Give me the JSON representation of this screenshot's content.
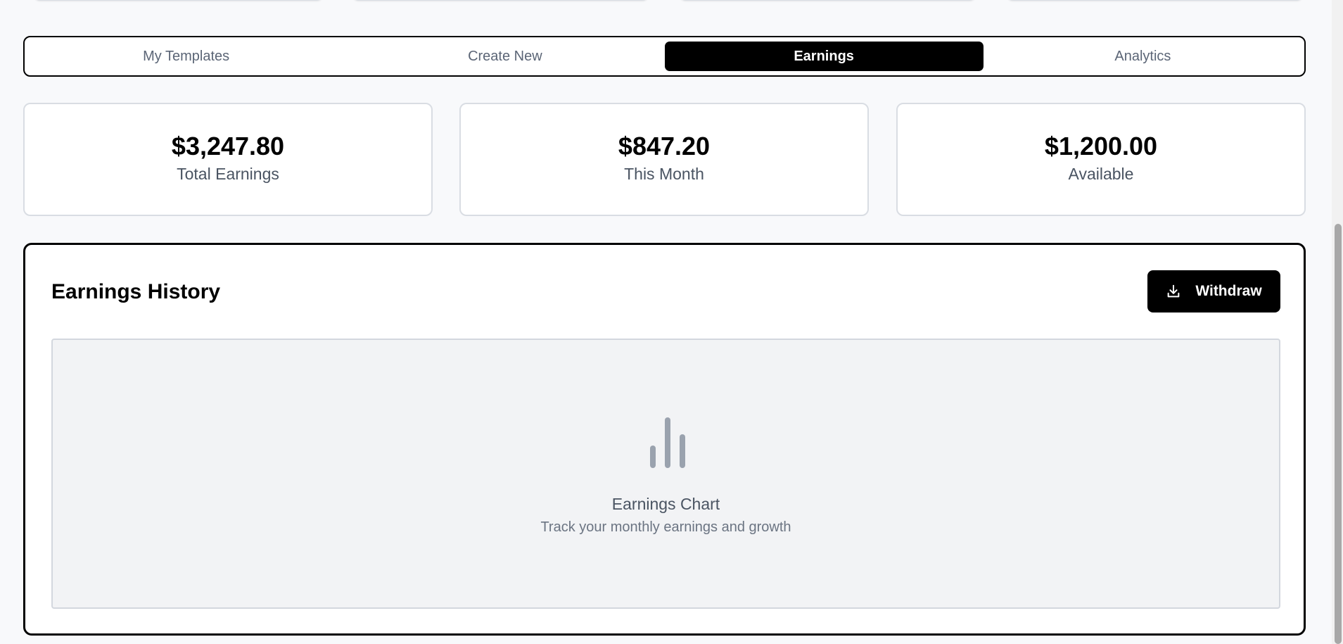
{
  "tabs": [
    {
      "label": "My Templates",
      "active": false
    },
    {
      "label": "Create New",
      "active": false
    },
    {
      "label": "Earnings",
      "active": true
    },
    {
      "label": "Analytics",
      "active": false
    }
  ],
  "stats": [
    {
      "value": "$3,247.80",
      "label": "Total Earnings"
    },
    {
      "value": "$847.20",
      "label": "This Month"
    },
    {
      "value": "$1,200.00",
      "label": "Available"
    }
  ],
  "earnings_history": {
    "title": "Earnings History",
    "withdraw_label": "Withdraw",
    "withdraw_icon": "download-icon",
    "chart_placeholder": {
      "icon": "bar-chart-icon",
      "title": "Earnings Chart",
      "subtitle": "Track your monthly earnings and growth"
    }
  },
  "colors": {
    "accent": "#000000",
    "page_bg": "#f8f9fb",
    "muted_text": "#5b6576",
    "placeholder_bg": "#f2f3f5"
  }
}
